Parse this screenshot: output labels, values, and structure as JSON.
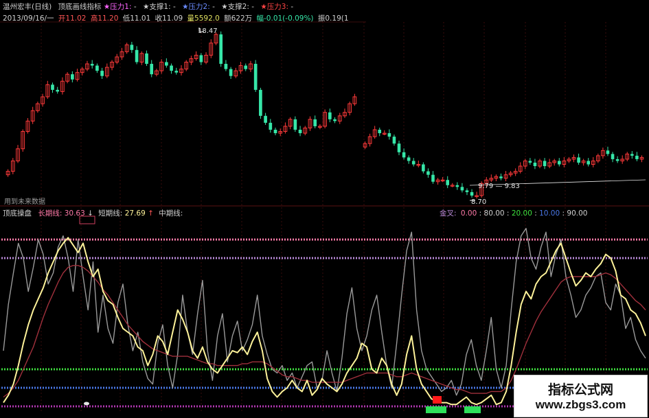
{
  "top_header": {
    "stock": "温州宏丰(日线)",
    "indicator": "顶底画线指标",
    "press1": "★压力1:",
    "press1_val": "-",
    "sup1": "★支撑1:",
    "sup1_val": "-",
    "press2": "★压力2:",
    "press2_val": "-",
    "sup2": "★支撑2:",
    "sup2_val": "-",
    "press3": "★压力3:",
    "press3_val": "-"
  },
  "ohlc": {
    "date": "2013/09/16/一",
    "open": "开11.02",
    "high": "高11.20",
    "low": "低11.01",
    "close": "收11.09",
    "vol": "量5592.0",
    "amount": "额622万",
    "change": "幅-0.01(-0.09%)",
    "vol_ratio": "振0.19(1"
  },
  "future_data_note": "用到未来数据",
  "price_labels": {
    "high": "18.47",
    "low": "8.70",
    "range": "9.79 — 9.83"
  },
  "bottom_header": {
    "title": "顶底操盘",
    "long_label": "长期线:",
    "long_val": "30.63",
    "short_label": "短期线:",
    "short_val": "27.69",
    "mid_label": "中期线:"
  },
  "bottom_right": {
    "label": "金叉:",
    "v1": "0.00",
    "v2": "80.00",
    "v3": "20.00",
    "v4": "10.00",
    "v5": "90.00"
  },
  "watermark": {
    "title": "指标公式网",
    "url": "www.zbgs3.com"
  },
  "colors": {
    "up": "#ff3a3a",
    "down": "#36e6a8",
    "short_line": "#fff39a",
    "long_line": "#a0303c",
    "mid_line": "#9a9a9a",
    "line90": "#ff7aa8",
    "line80": "#b98ad8",
    "line20": "#3ee23e",
    "line10": "#4a78e8",
    "line0": "#b036b0"
  },
  "chart_data": [
    {
      "type": "candlestick",
      "title": "温州宏丰(日线)",
      "annotations": [
        "18.47",
        "8.70",
        "9.79 — 9.83"
      ],
      "segments": [
        {
          "name": "segment-1",
          "closes": [
            10.3,
            10.9,
            11.6,
            12.6,
            13.2,
            13.8,
            14.2,
            14.6,
            15.3,
            15.0,
            14.9,
            15.5,
            15.9,
            15.6,
            16.0,
            16.2,
            16.5,
            16.4,
            16.1,
            15.8,
            16.3,
            16.6,
            16.9,
            17.2,
            17.6,
            17.3,
            16.6,
            17.1,
            16.5,
            15.9,
            16.1,
            16.6,
            16.4,
            16.1,
            16.0,
            16.2,
            16.6,
            16.8,
            17.0,
            16.6,
            17.0,
            17.7,
            18.2,
            16.5,
            16.2,
            15.8,
            16.1,
            16.4,
            16.2,
            16.5,
            15.0,
            13.5,
            13.1,
            12.7,
            12.5,
            12.6,
            12.9,
            13.3,
            12.7,
            12.5,
            12.8,
            13.3,
            12.9,
            12.9,
            13.7,
            13.3,
            13.2,
            13.5,
            13.7,
            14.2,
            14.6
          ]
        },
        {
          "name": "segment-2",
          "closes": [
            11.9,
            12.3,
            12.7,
            12.5,
            12.5,
            12.3,
            11.9,
            11.4,
            11.1,
            10.9,
            10.7,
            10.7,
            10.3,
            10.1,
            9.7,
            9.8,
            9.8,
            9.5,
            9.5,
            9.4,
            9.2,
            9.1,
            8.9,
            8.9,
            9.6,
            9.8,
            9.9,
            10.0,
            9.9,
            10.1,
            10.2,
            10.3,
            10.6,
            10.9,
            10.8,
            10.6,
            10.9,
            10.6,
            10.8,
            10.9,
            10.7,
            10.9,
            11.0,
            11.1,
            10.8,
            10.9,
            10.7,
            10.9,
            11.2,
            11.5,
            11.3,
            11.0,
            10.9,
            11.0,
            11.3,
            11.2,
            11.0,
            11.1
          ]
        }
      ]
    },
    {
      "type": "line",
      "title": "顶底操盘",
      "ylim": [
        0,
        100
      ],
      "reference_lines": [
        90,
        80,
        20,
        10,
        0
      ],
      "series": [
        {
          "name": "短期线",
          "color": "#fff39a",
          "values": [
            2,
            6,
            12,
            22,
            34,
            44,
            52,
            58,
            64,
            72,
            78,
            84,
            88,
            91,
            87,
            83,
            88,
            78,
            70,
            74,
            62,
            57,
            55,
            48,
            42,
            40,
            38,
            32,
            30,
            22,
            28,
            38,
            35,
            28,
            40,
            52,
            47,
            40,
            30,
            26,
            32,
            24,
            20,
            18,
            22,
            26,
            30,
            29,
            32,
            28,
            35,
            40,
            30,
            15,
            8,
            5,
            8,
            10,
            14,
            10,
            8,
            14,
            6,
            9,
            15,
            12,
            10,
            8,
            12,
            18,
            22,
            26,
            34,
            32,
            20,
            18,
            26,
            22,
            12,
            6,
            12,
            28,
            38,
            20,
            12,
            8,
            4,
            3,
            2,
            2,
            1,
            1,
            3,
            5,
            2,
            1,
            2,
            4,
            6,
            1,
            2,
            8,
            22,
            40,
            55,
            62,
            58,
            66,
            70,
            72,
            78,
            84,
            88,
            80,
            72,
            65,
            68,
            72,
            70,
            74,
            77,
            82,
            80,
            73,
            60,
            58,
            52,
            50,
            45,
            38
          ]
        },
        {
          "name": "长期线",
          "color": "#a0303c",
          "values": [
            5,
            7,
            10,
            14,
            20,
            26,
            32,
            40,
            48,
            55,
            61,
            67,
            72,
            75,
            76,
            76,
            75,
            73,
            70,
            67,
            63,
            60,
            56,
            52,
            48,
            44,
            41,
            38,
            35,
            33,
            31,
            30,
            29,
            28,
            27,
            27,
            27,
            27,
            26,
            25,
            24,
            23,
            23,
            22,
            22,
            22,
            22,
            22,
            23,
            23,
            24,
            24,
            24,
            23,
            21,
            19,
            17,
            16,
            16,
            15,
            14,
            14,
            13,
            13,
            13,
            13,
            13,
            13,
            13,
            14,
            15,
            16,
            17,
            18,
            18,
            18,
            18,
            18,
            17,
            16,
            16,
            17,
            18,
            17,
            16,
            15,
            14,
            13,
            12,
            11,
            10,
            9,
            9,
            8,
            7,
            7,
            7,
            7,
            8,
            8,
            8,
            10,
            14,
            20,
            27,
            34,
            40,
            46,
            51,
            55,
            59,
            63,
            67,
            69,
            70,
            70,
            70,
            70,
            70,
            70,
            71,
            72,
            71,
            69,
            66,
            63,
            60,
            57,
            55,
            52
          ]
        },
        {
          "name": "中期线",
          "color": "#9a9a9a",
          "values": [
            30,
            55,
            72,
            88,
            80,
            62,
            75,
            90,
            82,
            66,
            72,
            86,
            92,
            80,
            62,
            90,
            70,
            52,
            78,
            40,
            60,
            42,
            34,
            56,
            66,
            44,
            30,
            40,
            24,
            15,
            12,
            34,
            44,
            22,
            10,
            28,
            60,
            40,
            28,
            50,
            68,
            30,
            14,
            38,
            50,
            24,
            38,
            46,
            30,
            36,
            44,
            60,
            38,
            28,
            20,
            18,
            22,
            14,
            18,
            10,
            16,
            22,
            24,
            10,
            14,
            30,
            18,
            8,
            26,
            50,
            64,
            42,
            30,
            38,
            52,
            60,
            40,
            22,
            10,
            34,
            60,
            84,
            94,
            52,
            30,
            20,
            16,
            12,
            8,
            10,
            14,
            6,
            12,
            28,
            36,
            22,
            14,
            30,
            48,
            20,
            10,
            22,
            52,
            78,
            92,
            96,
            80,
            74,
            86,
            94,
            70,
            82,
            90,
            70,
            60,
            48,
            52,
            60,
            64,
            70,
            72,
            56,
            52,
            66,
            60,
            42,
            48,
            36,
            30,
            26
          ]
        }
      ]
    }
  ]
}
